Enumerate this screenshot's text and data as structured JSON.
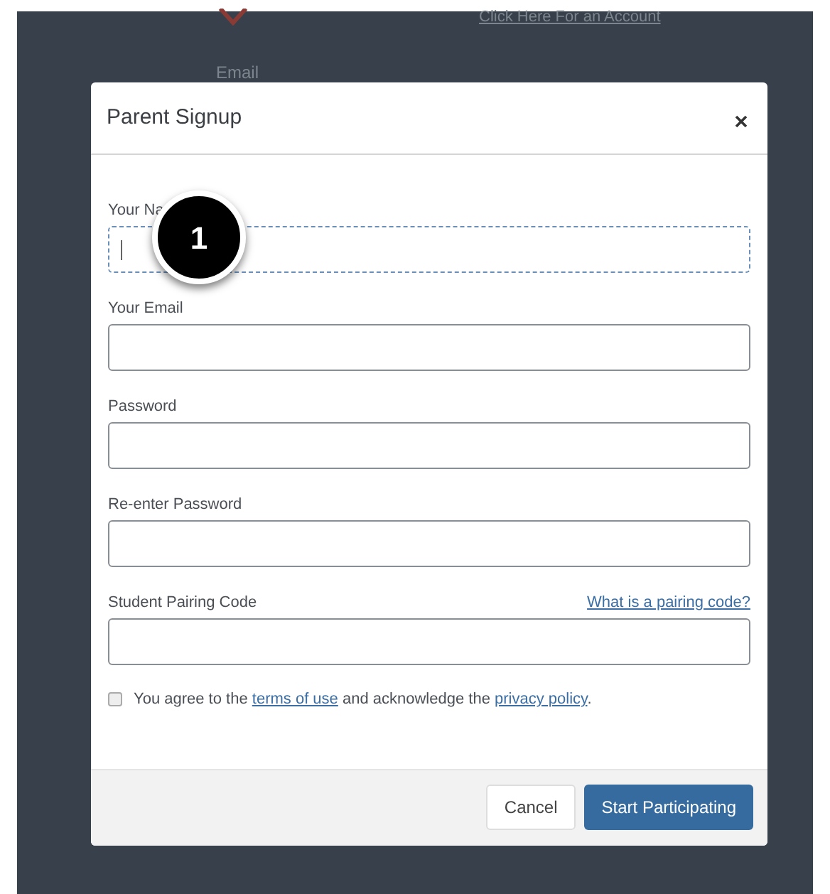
{
  "background": {
    "link": "Click Here For an Account",
    "email_label": "Email"
  },
  "dialog": {
    "title": "Parent Signup",
    "fields": [
      {
        "label": "Your Na",
        "focused": true
      },
      {
        "label": "Your Email",
        "focused": false
      },
      {
        "label": "Password",
        "focused": false
      },
      {
        "label": "Re-enter Password",
        "focused": false
      },
      {
        "label": "Student Pairing Code",
        "focused": false,
        "help_link": "What is a pairing code?"
      }
    ],
    "agreement": {
      "checked": false,
      "parts": [
        {
          "kind": "text",
          "text": "You agree to the "
        },
        {
          "kind": "link",
          "text": "terms of use"
        },
        {
          "kind": "text",
          "text": " and acknowledge the "
        },
        {
          "kind": "link",
          "text": "privacy policy"
        },
        {
          "kind": "text",
          "text": "."
        }
      ]
    },
    "buttons": [
      {
        "label": "Cancel",
        "kind": "secondary"
      },
      {
        "label": "Start Participating",
        "kind": "primary"
      }
    ]
  },
  "callout": {
    "number": "1"
  }
}
